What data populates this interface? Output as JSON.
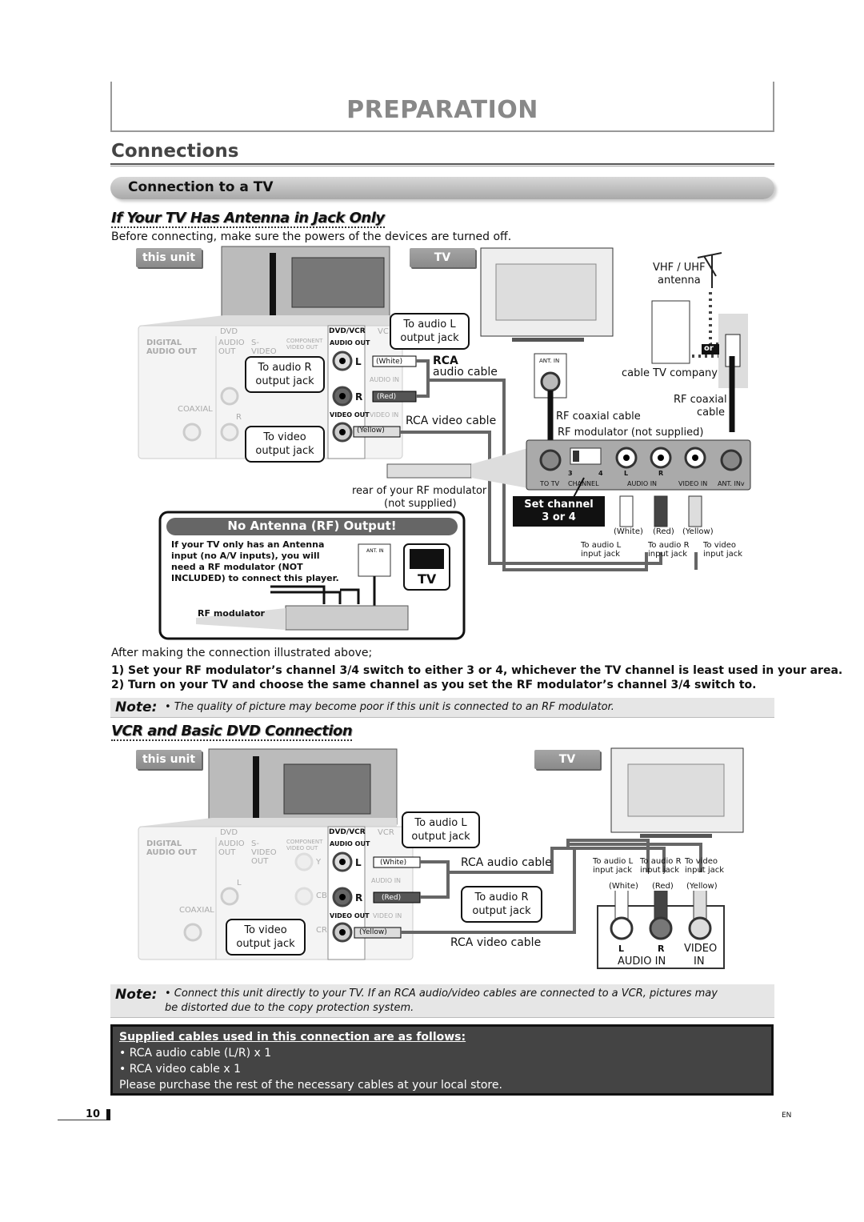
{
  "header": {
    "title": "PREPARATION"
  },
  "section": {
    "title": "Connections"
  },
  "bar": {
    "title": "Connection to a TV"
  },
  "part1": {
    "title": "If Your TV Has Antenna in Jack Only",
    "intro": "Before connecting, make sure the powers of the devices are turned off.",
    "tag_unit": "this unit",
    "tag_tv": "TV",
    "panel": {
      "dvd": "DVD",
      "digital": "DIGITAL AUDIO OUT",
      "audio_out": "AUDIO OUT",
      "svideo": "S-VIDEO OUT",
      "component": "COMPONENT VIDEO OUT",
      "coaxial": "COAXIAL",
      "l": "L",
      "r": "R",
      "dvdvcr": "DVD/VCR",
      "dvdvcr_audio": "AUDIO OUT",
      "video_out": "VIDEO OUT",
      "vcr": "VC",
      "audio_in": "AUDIO IN",
      "video_in": "VIDEO IN"
    },
    "call_l": "To audio L output jack",
    "call_r": "To audio R output jack",
    "call_v": "To video output jack",
    "white": "(White)",
    "red": "(Red)",
    "yellow": "(Yellow)",
    "rca_audio_1": "RCA",
    "rca_audio_2": "audio cable",
    "rca_video": "RCA video cable",
    "rear_mod_1": "rear of your RF modulator",
    "rear_mod_2": "(not supplied)",
    "ant_in": "ANT. IN",
    "antenna_1": "VHF / UHF",
    "antenna_2": "antenna",
    "or": "or",
    "cable_co": "cable TV company",
    "rf_cable_r1": "RF coaxial",
    "rf_cable_r2": "cable",
    "rf_cable_l": "RF coaxial cable",
    "rf_mod": "RF modulator (not supplied)",
    "mod": {
      "ch3": "3",
      "ch4": "4",
      "l": "L",
      "r": "R",
      "to_tv": "TO TV",
      "channel": "CHANNEL",
      "audio_in": "AUDIO IN",
      "video_in": "VIDEO IN",
      "ant_in": "ANT. INv"
    },
    "set_channel_1": "Set channel",
    "set_channel_2": "3 or 4",
    "in_l": "To audio L input jack",
    "in_r": "To audio R input jack",
    "in_v": "To video input jack",
    "box": {
      "title": "No Antenna (RF) Output!",
      "text": "If your TV only has an Antenna input (no A/V inputs), you will need a RF modulator (NOT INCLUDED) to connect this player.",
      "mod_label": "RF modulator",
      "ant_in": "ANT. IN",
      "tv": "TV"
    }
  },
  "after": "After making the connection illustrated above;",
  "steps": [
    "1) Set your RF modulator’s channel 3/4 switch to either 3 or 4, whichever the TV channel is least used in your area.",
    "2) Turn on your TV and choose the same channel as you set the RF modulator’s channel 3/4 switch to."
  ],
  "note1": {
    "label": "Note:",
    "text": "• The quality of picture may become poor if this unit is connected to an RF modulator."
  },
  "part2": {
    "title": "VCR and Basic DVD Connection",
    "tag_unit": "this unit",
    "tag_tv": "TV",
    "panel": {
      "dvd": "DVD",
      "digital": "DIGITAL AUDIO OUT",
      "audio_out": "AUDIO OUT",
      "svideo": "S-VIDEO OUT",
      "component": "COMPONENT VIDEO OUT",
      "coaxial": "COAXIAL",
      "l": "L",
      "r": "R",
      "y": "Y",
      "cb": "CB",
      "cr": "CR",
      "dvdvcr": "DVD/VCR",
      "dvdvcr_audio": "AUDIO OUT",
      "video_out": "VIDEO OUT",
      "vcr": "VCR",
      "audio_in": "AUDIO IN",
      "video_in": "VIDEO IN"
    },
    "call_l": "To audio L output jack",
    "call_r": "To audio R output jack",
    "call_v": "To video output jack",
    "white": "(White)",
    "red": "(Red)",
    "yellow": "(Yellow)",
    "rca_audio": "RCA audio cable",
    "rca_video": "RCA video cable",
    "in_l": "To audio L input jack",
    "in_r": "To audio R input jack",
    "in_v": "To video input jack",
    "tv_l": "L",
    "tv_r": "R",
    "tv_audio_in": "AUDIO IN",
    "tv_video": "VIDEO",
    "tv_in": "IN"
  },
  "note2": {
    "label": "Note:",
    "text": "• Connect this unit directly to your TV. If an RCA audio/video cables are connected to a VCR, pictures may be distorted due to the copy protection system."
  },
  "supplied": {
    "title": "Supplied cables used in this connection are as follows:",
    "items": [
      "RCA audio cable (L/R) x 1",
      "RCA video cable x 1"
    ],
    "footer": "Please purchase the rest of the necessary cables at your local store."
  },
  "footer": {
    "page": "10",
    "lang": "EN"
  }
}
